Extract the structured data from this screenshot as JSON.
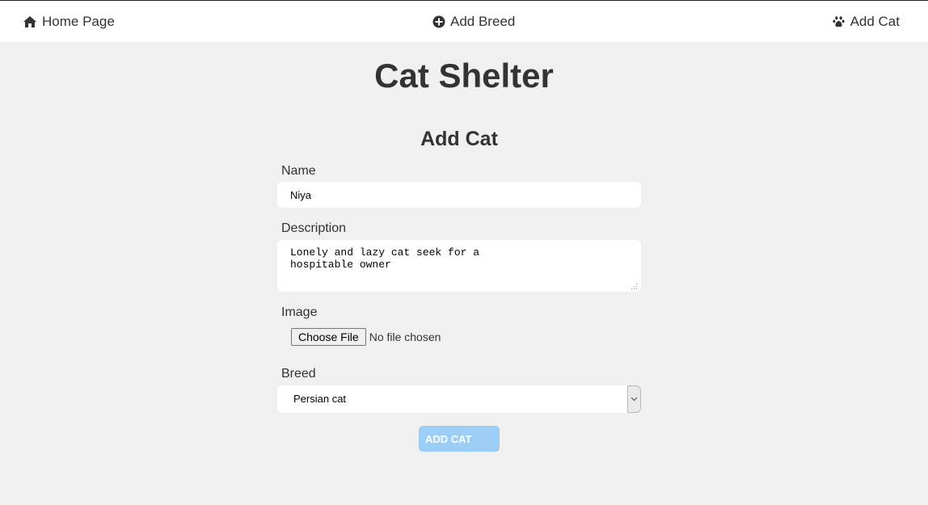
{
  "nav": {
    "home_label": "Home Page",
    "add_breed_label": "Add Breed",
    "add_cat_label": "Add Cat"
  },
  "site": {
    "title": "Cat Shelter"
  },
  "form": {
    "title": "Add Cat",
    "name_label": "Name",
    "name_value": "Niya",
    "description_label": "Description",
    "description_value": "Lonely and lazy cat seek for a\nhospitable owner",
    "image_label": "Image",
    "file_button_label": "Choose File",
    "file_status": "No file chosen",
    "breed_label": "Breed",
    "breed_selected": "Persian cat",
    "submit_label": "ADD CAT"
  },
  "colors": {
    "background": "#f0f0f0",
    "navbar": "#ffffff",
    "text": "#333333",
    "submit_button": "#9ccdf5"
  },
  "icons": {
    "home": "home-icon",
    "add_breed": "plus-circle-icon",
    "add_cat": "paw-icon",
    "select": "chevron-down-icon",
    "resize": "resize-grip-icon"
  }
}
